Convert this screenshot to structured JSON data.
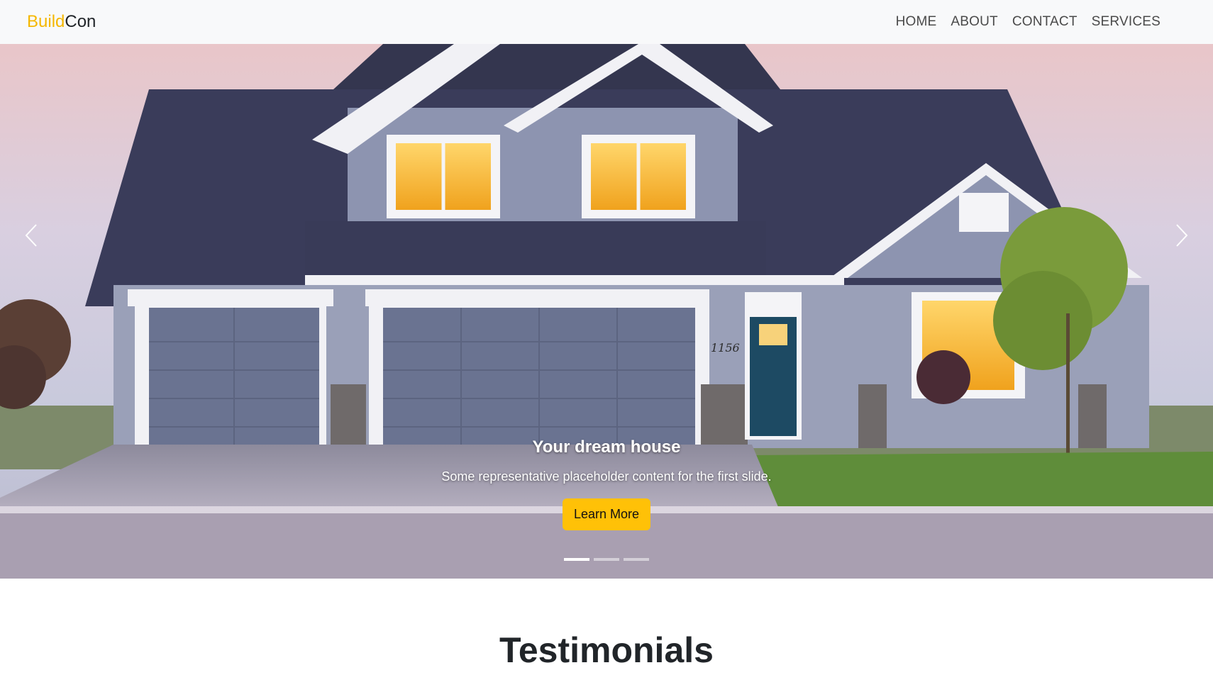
{
  "brand": {
    "part1": "Build",
    "part2": "Con"
  },
  "nav": {
    "items": [
      {
        "label": "HOME"
      },
      {
        "label": "ABOUT"
      },
      {
        "label": "CONTACT"
      },
      {
        "label": "SERVICES"
      }
    ]
  },
  "hero": {
    "title": "Your dream house",
    "text": "Some representative placeholder content for the first slide.",
    "button_label": "Learn More",
    "house_number": "1156",
    "slide_count": 3,
    "active_slide": 1
  },
  "testimonials": {
    "title": "Testimonials"
  },
  "colors": {
    "accent": "#ffc107",
    "brand_yellow": "#f5b700",
    "navbar_bg": "#f8f9fa"
  }
}
